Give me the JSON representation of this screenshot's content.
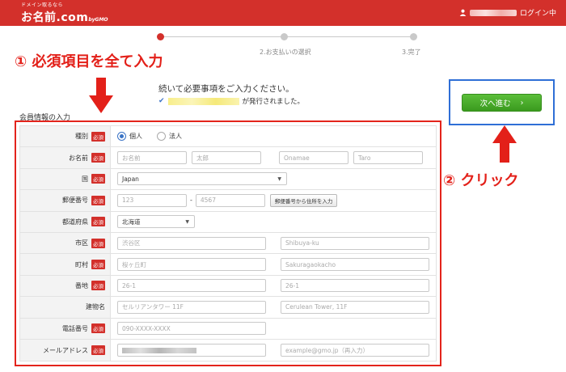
{
  "header": {
    "logo_tag": "ドメイン取るなら",
    "logo_main": "お名前.com",
    "logo_sub": "byGMO",
    "login_status": "ログイン中",
    "user_icon": "user-icon"
  },
  "steps": [
    {
      "label": ""
    },
    {
      "label": "2.お支払いの選択"
    },
    {
      "label": "3.完了"
    }
  ],
  "annotations": {
    "step1": "① 必須項目を全て入力",
    "step2": "② クリック"
  },
  "notice": {
    "title": "続いて必要事項をご入力ください。",
    "issued": "が発行されました。"
  },
  "next_button": {
    "label": "次へ進む",
    "icon": "chevron-right-icon"
  },
  "section_title": "会員情報の入力",
  "required_badge": "必須",
  "form": {
    "type": {
      "label": "種別",
      "options": [
        "個人",
        "法人"
      ],
      "selected": "個人"
    },
    "name": {
      "label": "お名前",
      "placeholders": [
        "お名前",
        "太郎",
        "Onamae",
        "Taro"
      ]
    },
    "country": {
      "label": "国",
      "value": "Japan"
    },
    "postal": {
      "label": "郵便番号",
      "placeholders": [
        "123",
        "4567"
      ],
      "separator": "-",
      "lookup_button": "郵便番号から住所を入力"
    },
    "prefecture": {
      "label": "都道府県",
      "value": "北海道"
    },
    "city": {
      "label": "市区",
      "placeholders": [
        "渋谷区",
        "Shibuya-ku"
      ]
    },
    "town": {
      "label": "町村",
      "placeholders": [
        "桜ヶ丘町",
        "Sakuragaokacho"
      ]
    },
    "address": {
      "label": "番地",
      "placeholders": [
        "26-1",
        "26-1"
      ]
    },
    "building": {
      "label": "建物名",
      "placeholders": [
        "セルリアンタワー 11F",
        "Cerulean Tower, 11F"
      ]
    },
    "phone": {
      "label": "電話番号",
      "placeholder": "090-XXXX-XXXX"
    },
    "email": {
      "label": "メールアドレス",
      "placeholder_confirm": "example@gmo.jp（再入力）"
    }
  },
  "colors": {
    "brand": "#d3302b",
    "button_green": "#3a9a1e",
    "annotation_red": "#e32019",
    "highlight_blue": "#2f6fd6"
  }
}
